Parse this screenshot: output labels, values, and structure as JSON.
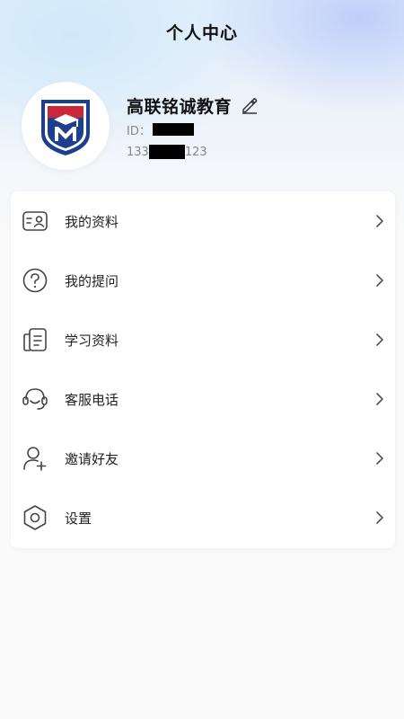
{
  "page": {
    "title": "个人中心"
  },
  "profile": {
    "name": "高联铭诚教育",
    "id_label": "ID：",
    "phone_prefix": "133",
    "phone_suffix": "123",
    "avatar_icon": "school-shield-logo",
    "edit_icon": "pencil-icon"
  },
  "menu": {
    "items": [
      {
        "label": "我的资料",
        "icon": "id-card-icon"
      },
      {
        "label": "我的提问",
        "icon": "question-circle-icon"
      },
      {
        "label": "学习资料",
        "icon": "document-icon"
      },
      {
        "label": "客服电话",
        "icon": "headset-icon"
      },
      {
        "label": "邀请好友",
        "icon": "user-add-icon"
      },
      {
        "label": "设置",
        "icon": "settings-hexagon-icon"
      }
    ]
  },
  "colors": {
    "logo_blue": "#1e3f8f",
    "logo_red": "#c8283a",
    "icon_gray": "#444444",
    "chevron_gray": "#555555"
  }
}
